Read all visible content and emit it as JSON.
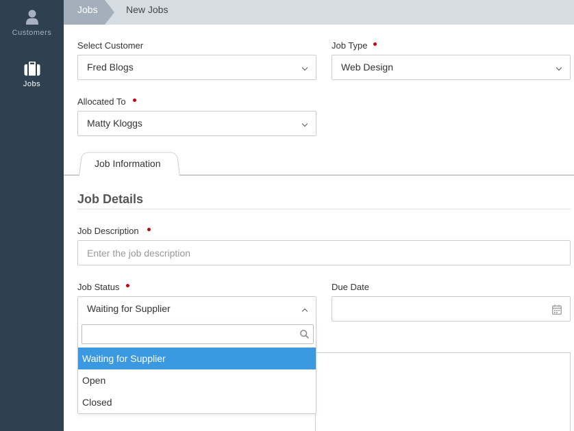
{
  "sidebar": {
    "items": [
      {
        "label": "Customers",
        "icon": "user-icon"
      },
      {
        "label": "Jobs",
        "icon": "briefcase-icon"
      }
    ]
  },
  "breadcrumb": {
    "items": [
      "Jobs",
      "New Jobs"
    ]
  },
  "form": {
    "customer": {
      "label": "Select Customer",
      "value": "Fred Blogs"
    },
    "job_type": {
      "label": "Job Type",
      "value": "Web Design"
    },
    "allocated_to": {
      "label": "Allocated To",
      "value": "Matty Kloggs"
    },
    "tab": {
      "label": "Job Information"
    },
    "section_title": "Job Details",
    "job_description": {
      "label": "Job Description",
      "placeholder": "Enter the job description",
      "value": ""
    },
    "job_status": {
      "label": "Job Status",
      "value": "Waiting for Supplier",
      "search_value": "",
      "options": [
        "Waiting for Supplier",
        "Open",
        "Closed"
      ]
    },
    "due_date": {
      "label": "Due Date",
      "value": ""
    }
  },
  "colors": {
    "sidebar_bg": "#2f4050",
    "topbar_bg": "#d5dde3",
    "breadcrumb_active_bg": "#a3b0bc",
    "required_dot": "#c5000f",
    "option_selected": "#3a99e0"
  }
}
